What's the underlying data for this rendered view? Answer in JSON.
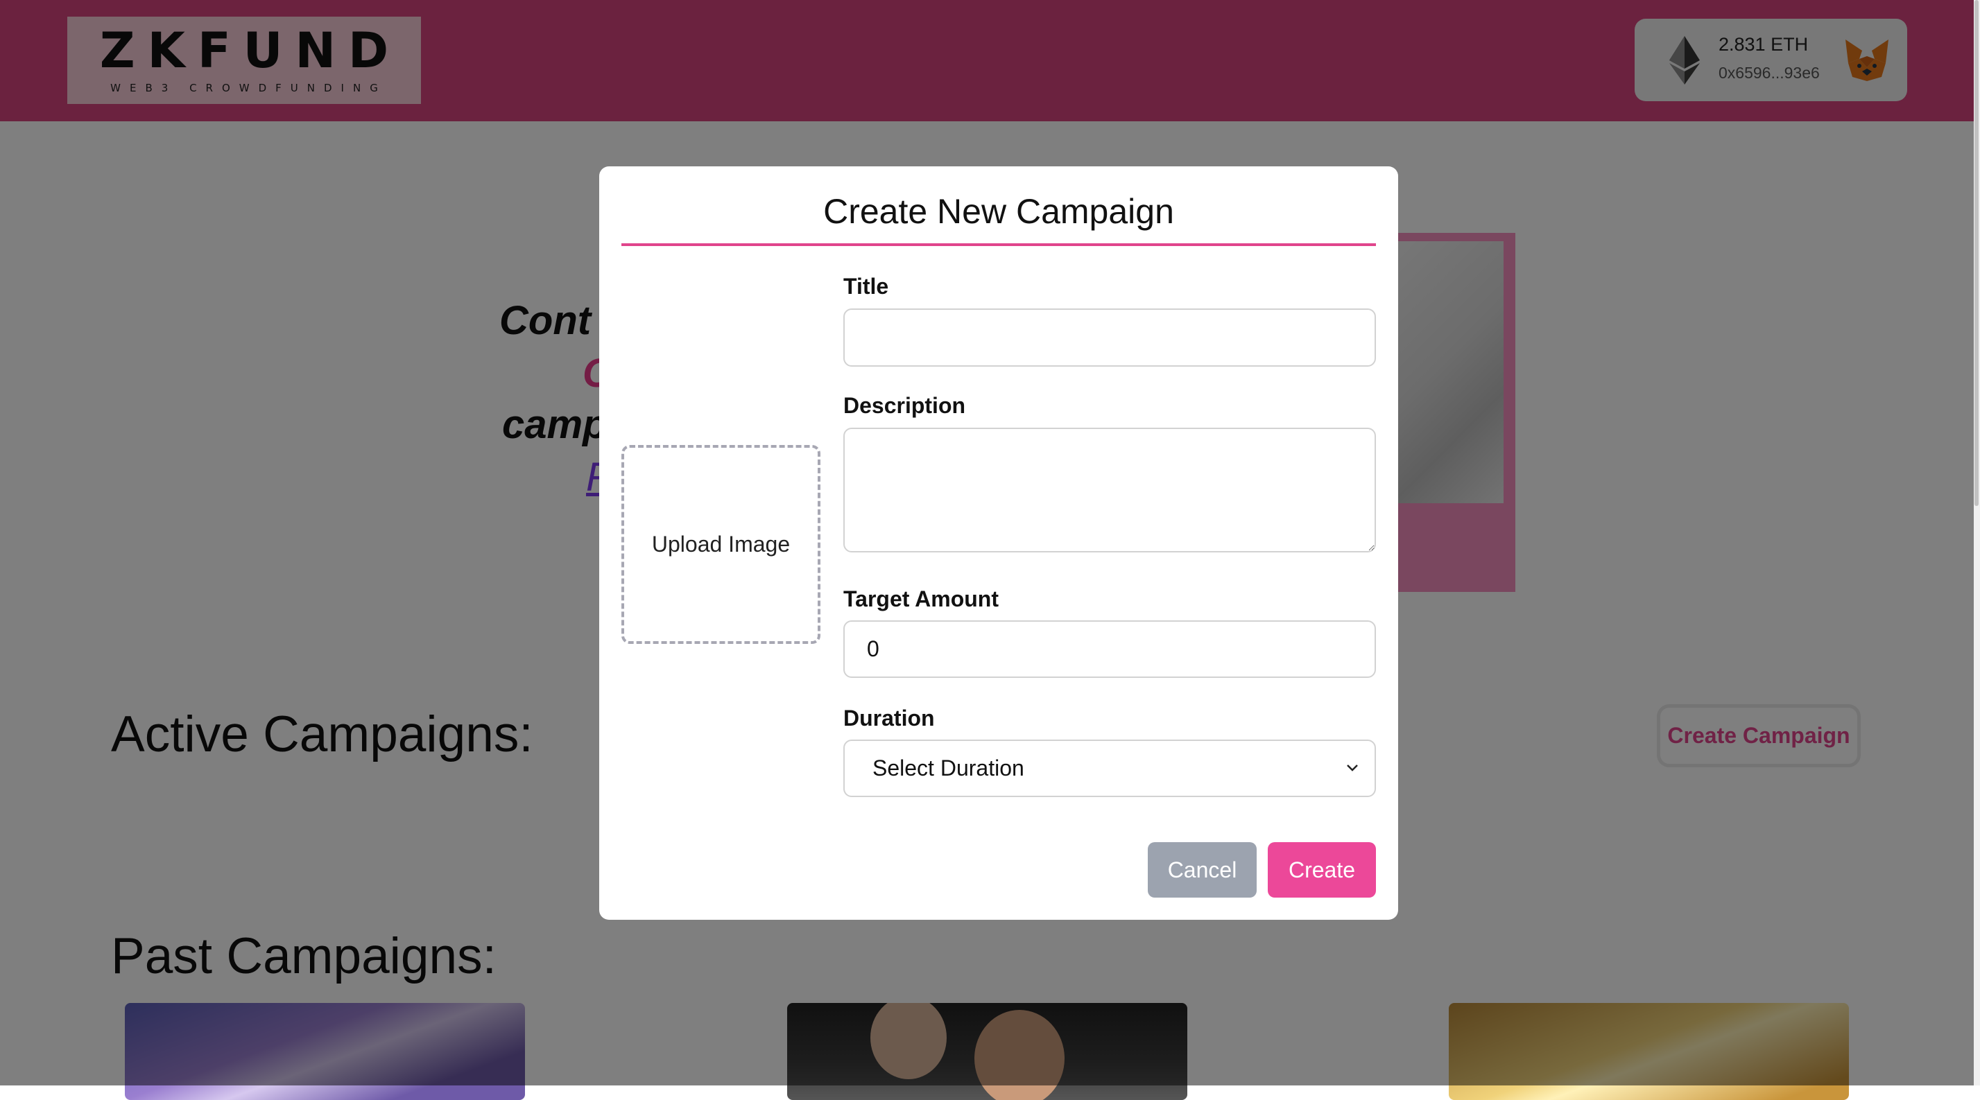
{
  "header": {
    "logo_main": "ZKFUND",
    "logo_sub": "WEB3 CROWDFUNDING",
    "wallet": {
      "balance": "2.831 ETH",
      "address": "0x6596...93e6",
      "network_icon": "ethereum-icon",
      "wallet_icon": "metamask-fox-icon"
    }
  },
  "hero": {
    "line1": "Cont",
    "line2": "C",
    "line3": "camp",
    "link": "F"
  },
  "main": {
    "active_heading": "Active Campaigns:",
    "create_campaign_label": "Create Campaign",
    "past_heading": "Past Campaigns:"
  },
  "modal": {
    "title": "Create New Campaign",
    "upload_label": "Upload Image",
    "title_label": "Title",
    "title_value": "",
    "description_label": "Description",
    "description_value": "",
    "target_label": "Target Amount",
    "target_value": "0",
    "duration_label": "Duration",
    "duration_selected": "Select Duration",
    "cancel_label": "Cancel",
    "create_label": "Create"
  },
  "colors": {
    "header_bg": "#d7457f",
    "accent": "#ec4899",
    "cancel_bg": "#9ca3af"
  }
}
